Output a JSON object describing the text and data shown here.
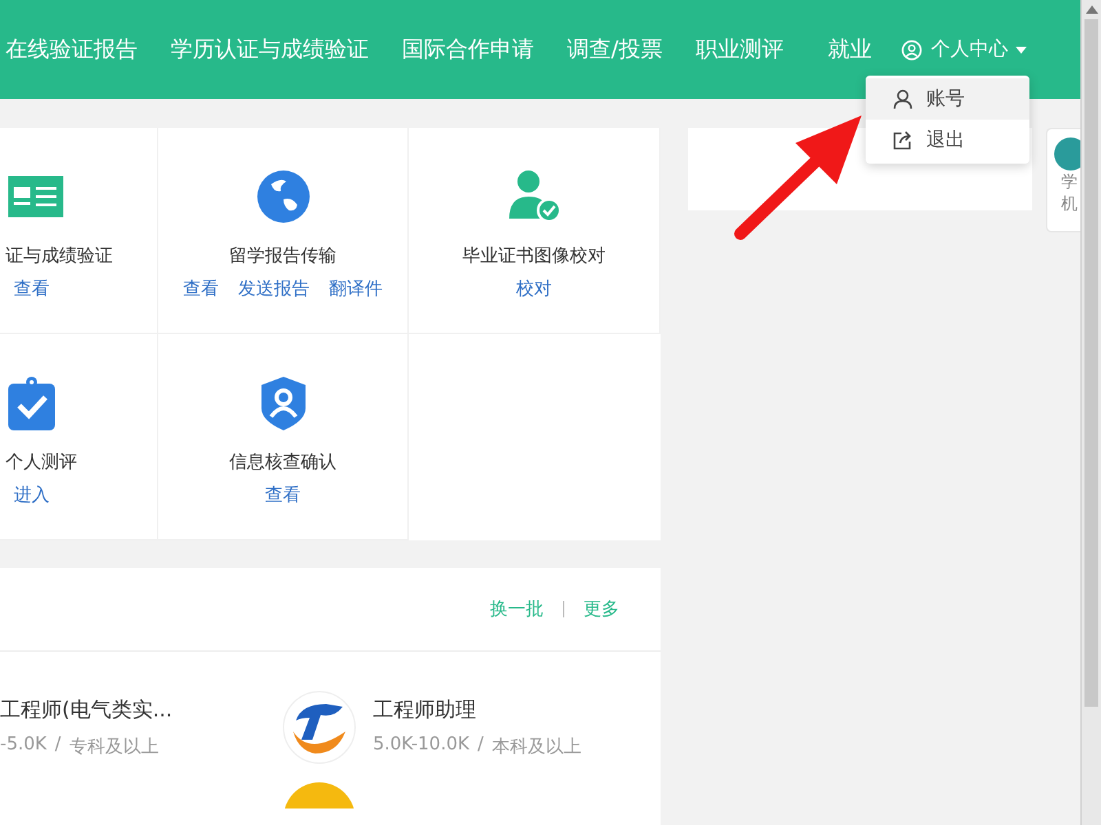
{
  "nav": {
    "items": [
      "在线验证报告",
      "学历认证与成绩验证",
      "国际合作申请",
      "调查/投票",
      "职业测评",
      "就业"
    ],
    "user_menu": {
      "label": "个人中心",
      "expanded": true,
      "items": [
        {
          "label": "账号",
          "kind": "account",
          "selected": true
        },
        {
          "label": "退出",
          "kind": "logout",
          "selected": false
        }
      ]
    }
  },
  "services": [
    {
      "kind": "id-card",
      "title": "证与成绩验证",
      "links": [
        "查看"
      ]
    },
    {
      "kind": "globe",
      "title": "留学报告传输",
      "links": [
        "查看",
        "发送报告",
        "翻译件"
      ]
    },
    {
      "kind": "user-check",
      "title": "毕业证书图像校对",
      "links": [
        "校对"
      ]
    },
    {
      "kind": "clipboard",
      "title": "个人测评",
      "links": [
        "进入"
      ]
    },
    {
      "kind": "shield",
      "title": "信息核查确认",
      "links": [
        "查看"
      ]
    }
  ],
  "jobs": {
    "actions": [
      "换一批",
      "更多"
    ],
    "items": [
      {
        "title": "工程师(电气类实...",
        "salary": "-5.0K",
        "separator": "/",
        "education": "专科及以上",
        "has_logo": false
      },
      {
        "title": "工程师助理",
        "salary": "5.0K-10.0K",
        "separator": "/",
        "education": "本科及以上",
        "has_logo": true
      }
    ]
  },
  "side_widget": {
    "lines": [
      "学",
      "机"
    ]
  }
}
